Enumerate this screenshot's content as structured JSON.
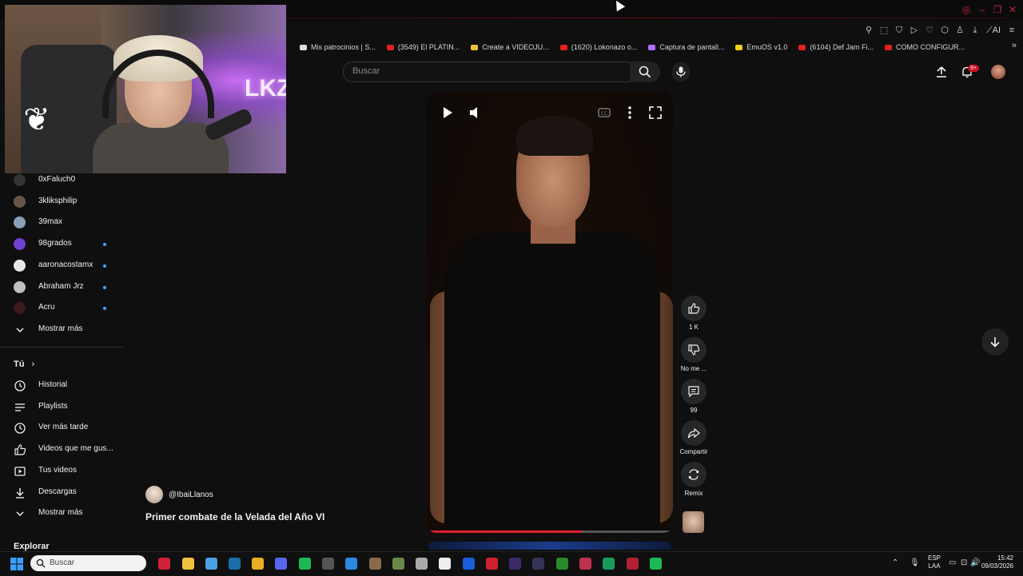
{
  "bookmarks": [
    {
      "label": "Mis patrocinios | S...",
      "color": "#dcdcdc"
    },
    {
      "label": "(3549) El PLATIN...",
      "color": "#e02020"
    },
    {
      "label": "Create a VIDEOJU...",
      "color": "#f0c040"
    },
    {
      "label": "(1620) Lokonazo o...",
      "color": "#e02020"
    },
    {
      "label": "Captura de pantall...",
      "color": "#b070ff"
    },
    {
      "label": "EmuOS v1.0",
      "color": "#f0d020"
    },
    {
      "label": "(6104) Def Jam Fi...",
      "color": "#e02020"
    },
    {
      "label": "COMO CONFIGUR...",
      "color": "#e02020"
    }
  ],
  "header": {
    "search_placeholder": "Buscar",
    "notifications_badge": "9+"
  },
  "sidebar": {
    "subscriptions": [
      {
        "label": "0xFaluch0",
        "color": "#333333"
      },
      {
        "label": "3kliksphilip",
        "color": "#6a5648",
        "dot": false
      },
      {
        "label": "39max",
        "color": "#8aa0b8",
        "dot": false
      },
      {
        "label": "98grados",
        "color": "#7040d0",
        "dot": true
      },
      {
        "label": "aaronacostamx",
        "color": "#e8e8e8",
        "dot": true
      },
      {
        "label": "Abraham Jrz",
        "color": "#c0c0c0",
        "dot": true
      },
      {
        "label": "Acru",
        "color": "#3a1a1a",
        "dot": true
      }
    ],
    "show_more_1": "Mostrar más",
    "you_title": "Tú",
    "you_items": [
      {
        "label": "Historial",
        "icon": "history-icon"
      },
      {
        "label": "Playlists",
        "icon": "playlists-icon"
      },
      {
        "label": "Ver más tarde",
        "icon": "watch-later-icon"
      },
      {
        "label": "Videos que me gus...",
        "icon": "liked-videos-icon"
      },
      {
        "label": "Tus videos",
        "icon": "your-videos-icon"
      },
      {
        "label": "Descargas",
        "icon": "downloads-icon"
      }
    ],
    "show_more_2": "Mostrar más",
    "explore_title": "Explorar"
  },
  "short": {
    "channel": "@IbaiLlanos",
    "title": "Primer combate de la Velada del Año VI",
    "progress": 0.63,
    "actions": {
      "like_count": "1 K",
      "dislike_label": "No me ...",
      "comments_count": "99",
      "share_label": "Compartir",
      "remix_label": "Remix"
    }
  },
  "taskbar": {
    "search_placeholder": "Buscar",
    "lang_line1": "ESP",
    "lang_line2": "LAA",
    "time": "15:42",
    "date": "09/03/2026"
  },
  "colors": {
    "background": "#0f0f0f",
    "accent_red": "#e0202e",
    "link_blue": "#3ea6ff"
  }
}
